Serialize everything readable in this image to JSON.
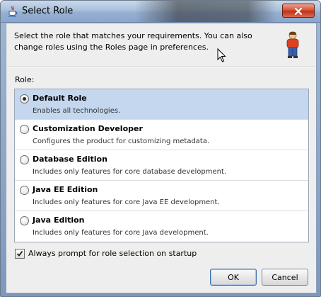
{
  "window": {
    "title": "Select Role",
    "app_icon": "java-cup-icon",
    "close_icon": "close-icon"
  },
  "header": {
    "description": "Select the role that matches your requirements. You can also change roles using the Roles page in preferences.",
    "illustration_icon": "person-icon"
  },
  "roles": {
    "label": "Role:",
    "items": [
      {
        "name": "Default Role",
        "description": "Enables all technologies.",
        "selected": true
      },
      {
        "name": "Customization Developer",
        "description": "Configures the product for customizing metadata.",
        "selected": false
      },
      {
        "name": "Database Edition",
        "description": "Includes only features for core database development.",
        "selected": false
      },
      {
        "name": "Java EE Edition",
        "description": "Includes only features for core Java EE development.",
        "selected": false
      },
      {
        "name": "Java Edition",
        "description": "Includes only features for core Java development.",
        "selected": false
      }
    ]
  },
  "prompt_checkbox": {
    "label": "Always prompt for role selection on startup",
    "checked": true
  },
  "buttons": {
    "ok": "OK",
    "cancel": "Cancel"
  },
  "colors": {
    "selected_row": "#c4d7ee",
    "close_button": "#c0301a"
  }
}
